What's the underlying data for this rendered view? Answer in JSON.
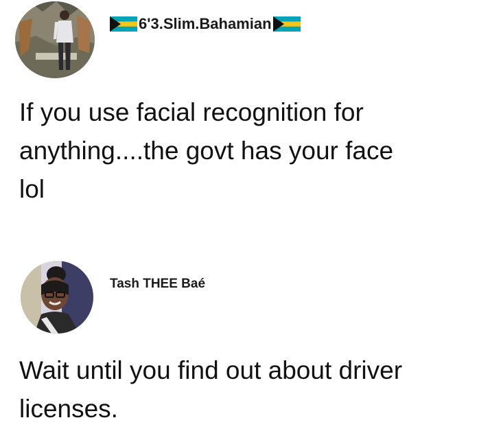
{
  "posts": [
    {
      "username": "6'3.Slim.Bahamian",
      "avatar_icon": "person-standing-outdoors-photo",
      "flag_icon": "bahamas-flag-icon",
      "flag_colors": {
        "black": "#111111",
        "aqua": "#00a3b8",
        "gold": "#f5c518"
      },
      "text_lines": [
        "If you use facial recognition for",
        "anything....the govt has your face",
        "lol"
      ]
    },
    {
      "username": "Tash THEE Baé",
      "avatar_icon": "woman-selfie-photo",
      "text_lines": [
        "Wait until you find out about driver",
        "licenses."
      ]
    }
  ]
}
